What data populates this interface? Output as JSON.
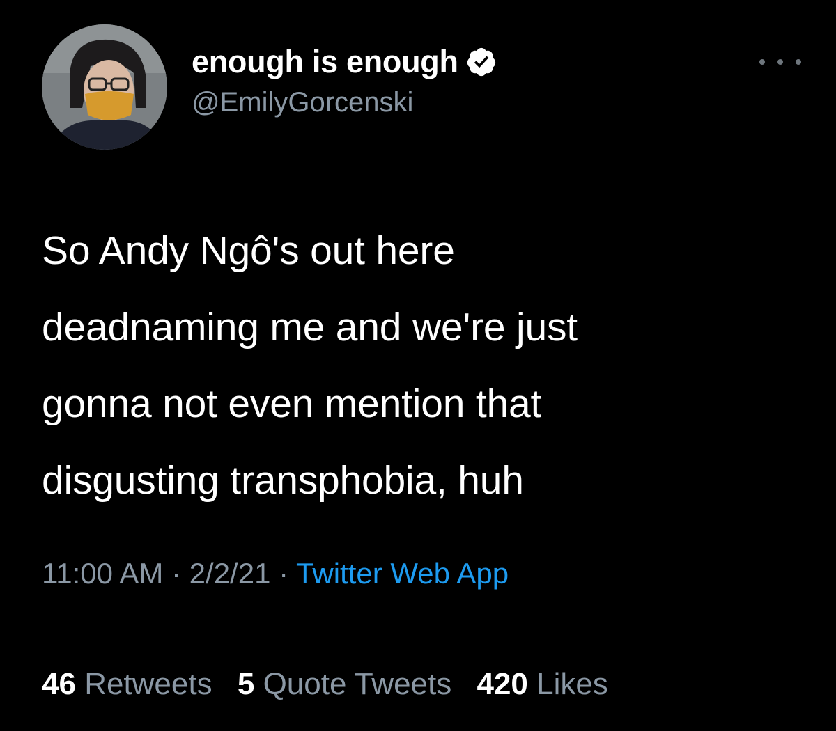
{
  "author": {
    "display_name": "enough is enough",
    "handle": "@EmilyGorcenski",
    "verified_icon": "verified-badge-icon",
    "avatar": "profile-photo"
  },
  "menu": {
    "icon": "more-options-icon"
  },
  "tweet": {
    "lines": [
      "So Andy Ngô's out here",
      "deadnaming me and we're just",
      "gonna not even mention that",
      "disgusting transphobia, huh"
    ]
  },
  "meta": {
    "time": "11:00 AM",
    "separator": " · ",
    "date": "2/2/21",
    "source": "Twitter Web App"
  },
  "stats": {
    "retweets_count": "46",
    "retweets_label": "Retweets",
    "quotes_count": "5",
    "quotes_label": "Quote Tweets",
    "likes_count": "420",
    "likes_label": "Likes"
  },
  "colors": {
    "background": "#000000",
    "primary_text": "#ffffff",
    "secondary_text": "#8b98a5",
    "link": "#1d9bf0",
    "divider": "#2f3336"
  }
}
